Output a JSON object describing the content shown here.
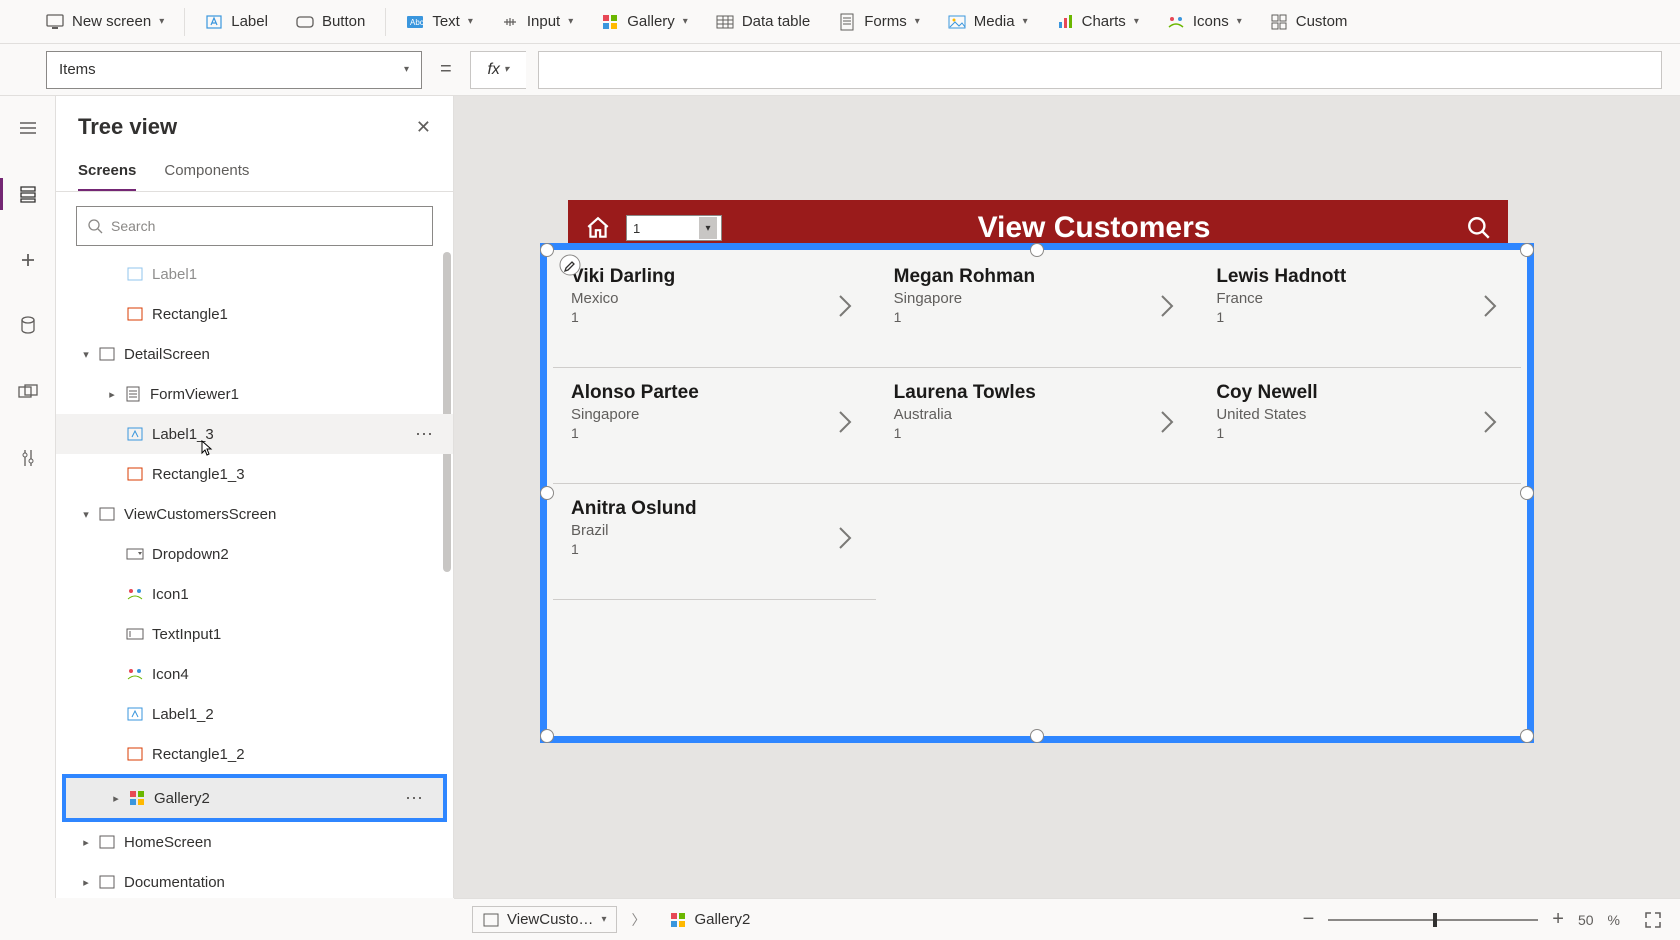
{
  "ribbon": {
    "new_screen": "New screen",
    "label": "Label",
    "button": "Button",
    "text": "Text",
    "input": "Input",
    "gallery": "Gallery",
    "data_table": "Data table",
    "forms": "Forms",
    "media": "Media",
    "charts": "Charts",
    "icons": "Icons",
    "custom": "Custom"
  },
  "formula": {
    "property": "Items",
    "fx": "fx"
  },
  "tree": {
    "title": "Tree view",
    "tab_screens": "Screens",
    "tab_components": "Components",
    "search_placeholder": "Search",
    "rows": {
      "label1": "Label1",
      "rectangle1": "Rectangle1",
      "detailscreen": "DetailScreen",
      "formviewer1": "FormViewer1",
      "label1_3": "Label1_3",
      "rectangle1_3": "Rectangle1_3",
      "viewcustomersscreen": "ViewCustomersScreen",
      "dropdown2": "Dropdown2",
      "icon1": "Icon1",
      "textinput1": "TextInput1",
      "icon4": "Icon4",
      "label1_2": "Label1_2",
      "rectangle1_2": "Rectangle1_2",
      "gallery2": "Gallery2",
      "homescreen": "HomeScreen",
      "documentation": "Documentation"
    }
  },
  "app": {
    "title": "View Customers",
    "dropdown_value": "1",
    "customers": [
      {
        "name": "Viki  Darling",
        "sub": "Mexico",
        "num": "1"
      },
      {
        "name": "Megan  Rohman",
        "sub": "Singapore",
        "num": "1"
      },
      {
        "name": "Lewis  Hadnott",
        "sub": "France",
        "num": "1"
      },
      {
        "name": "Alonso  Partee",
        "sub": "Singapore",
        "num": "1"
      },
      {
        "name": "Laurena  Towles",
        "sub": "Australia",
        "num": "1"
      },
      {
        "name": "Coy  Newell",
        "sub": "United States",
        "num": "1"
      },
      {
        "name": "Anitra  Oslund",
        "sub": "Brazil",
        "num": "1"
      }
    ]
  },
  "breadcrumb": {
    "screen": "ViewCusto…",
    "item": "Gallery2"
  },
  "zoom": {
    "value": "50",
    "unit": "%"
  }
}
